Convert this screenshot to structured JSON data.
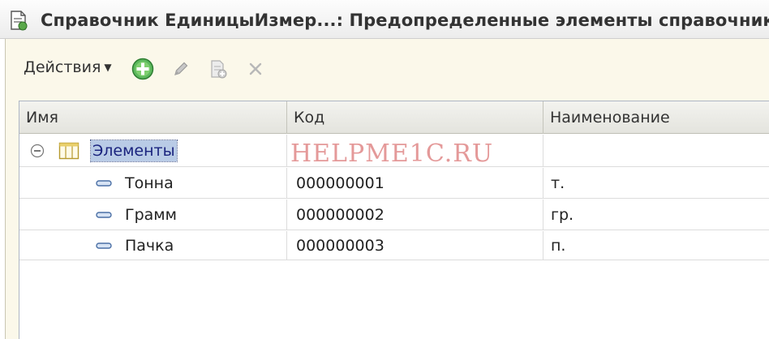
{
  "window": {
    "title": "Справочник ЕдиницыИзмер...: Предопределенные элементы справочника"
  },
  "toolbar": {
    "actions_label": "Действия",
    "buttons": [
      "add-icon",
      "edit-icon",
      "copy-icon",
      "delete-icon"
    ]
  },
  "table": {
    "columns": [
      "Имя",
      "Код",
      "Наименование"
    ],
    "group": {
      "name": "Элементы",
      "expanded": true
    },
    "rows": [
      {
        "name": "Тонна",
        "code": "000000001",
        "description": "т."
      },
      {
        "name": "Грамм",
        "code": "000000002",
        "description": "гр."
      },
      {
        "name": "Пачка",
        "code": "000000003",
        "description": "п."
      }
    ]
  },
  "watermark": "HELPME1C.RU",
  "colors": {
    "add_green": "#4caf50",
    "selection": "#b9cbe6",
    "frame_bg": "#fbf8ea",
    "watermark": "#cd4646"
  }
}
